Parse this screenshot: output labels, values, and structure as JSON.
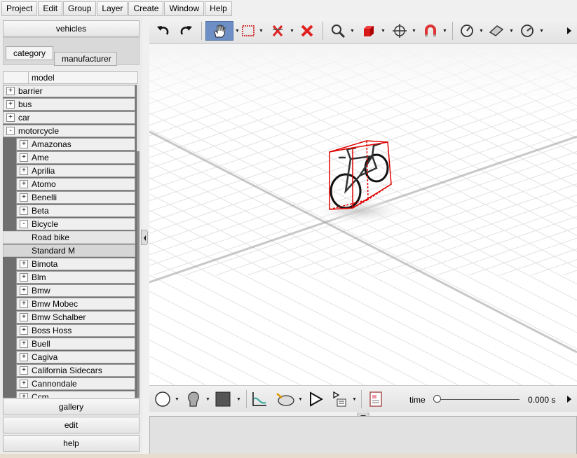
{
  "menu": [
    "Project",
    "Edit",
    "Group",
    "Layer",
    "Create",
    "Window",
    "Help"
  ],
  "left_panel": {
    "top_button": "vehicles",
    "tabs": [
      "category",
      "manufacturer"
    ],
    "column_header": "model",
    "tree": [
      {
        "label": "barrier",
        "expander": "+",
        "level": 0
      },
      {
        "label": "bus",
        "expander": "+",
        "level": 0
      },
      {
        "label": "car",
        "expander": "+",
        "level": 0
      },
      {
        "label": "motorcycle",
        "expander": "-",
        "level": 0
      },
      {
        "label": "Amazonas",
        "expander": "+",
        "level": 1
      },
      {
        "label": "Ame",
        "expander": "+",
        "level": 1
      },
      {
        "label": "Aprilia",
        "expander": "+",
        "level": 1
      },
      {
        "label": "Atomo",
        "expander": "+",
        "level": 1
      },
      {
        "label": "Benelli",
        "expander": "+",
        "level": 1
      },
      {
        "label": "Beta",
        "expander": "+",
        "level": 1
      },
      {
        "label": "Bicycle",
        "expander": "-",
        "level": 1
      },
      {
        "label": "Road bike",
        "expander": "",
        "level": 2,
        "state": "hover"
      },
      {
        "label": "Standard M",
        "expander": "",
        "level": 2,
        "state": "selected"
      },
      {
        "label": "Bimota",
        "expander": "+",
        "level": 1
      },
      {
        "label": "Blm",
        "expander": "+",
        "level": 1
      },
      {
        "label": "Bmw",
        "expander": "+",
        "level": 1
      },
      {
        "label": "Bmw Mobec",
        "expander": "+",
        "level": 1
      },
      {
        "label": "Bmw Schalber",
        "expander": "+",
        "level": 1
      },
      {
        "label": "Boss Hoss",
        "expander": "+",
        "level": 1
      },
      {
        "label": "Buell",
        "expander": "+",
        "level": 1
      },
      {
        "label": "Cagiva",
        "expander": "+",
        "level": 1
      },
      {
        "label": "California Sidecars",
        "expander": "+",
        "level": 1
      },
      {
        "label": "Cannondale",
        "expander": "+",
        "level": 1
      },
      {
        "label": "Ccm",
        "expander": "+",
        "level": 1
      }
    ],
    "bottom_buttons": [
      "gallery",
      "edit",
      "help"
    ]
  },
  "top_toolbar": {
    "tools": [
      "undo-icon",
      "redo-icon",
      "pan-hand-icon",
      "select-rect-icon",
      "delete-link-icon",
      "delete-icon",
      "zoom-icon",
      "cube-icon",
      "move-icon",
      "magnet-icon",
      "compass-icon",
      "plane-icon",
      "dial-icon",
      "overflow-arrow-icon"
    ],
    "active_tool": "pan-hand-icon",
    "colors": {
      "active": "#6d8fc6",
      "delete": "#e02020",
      "cube": "#d81818"
    }
  },
  "bottom_toolbar": {
    "tools": [
      "circle-icon",
      "head-icon",
      "color-swatch-icon",
      "graph-icon",
      "pig-icon",
      "play-icon",
      "sequence-icon",
      "document-icon",
      "overflow-arrow-icon"
    ],
    "time_label": "time",
    "time_value": "0.000 s",
    "time_position": 0
  },
  "viewport": {
    "object": "bicycle-model",
    "selection_color": "#e00000"
  }
}
